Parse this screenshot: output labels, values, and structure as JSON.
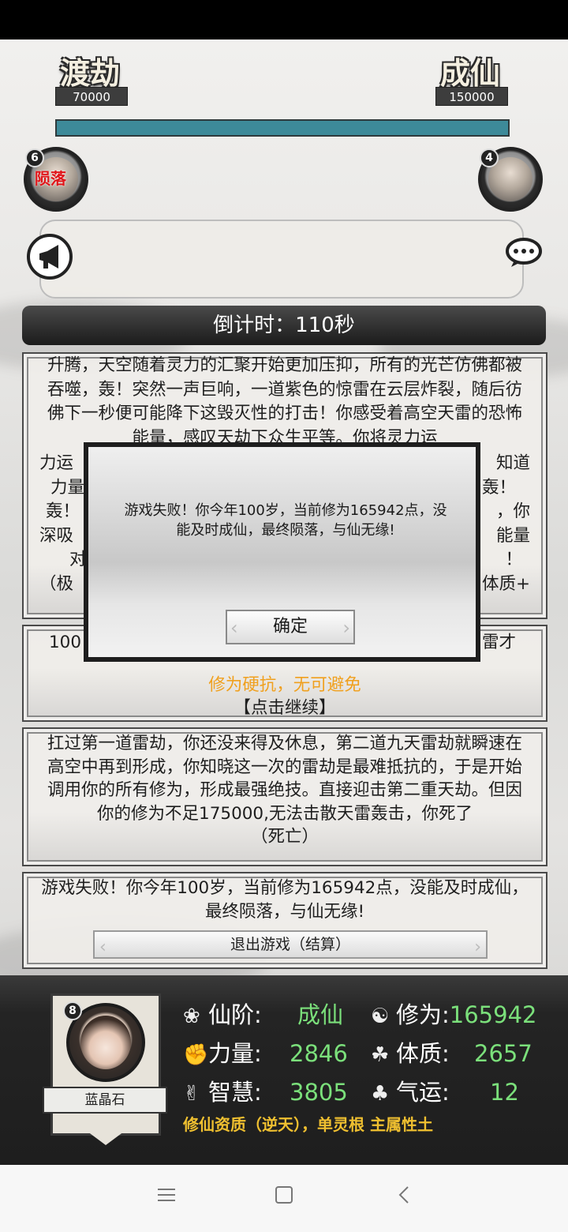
{
  "header": {
    "left_stage": "渡劫",
    "left_value": "70000",
    "right_stage": "成仙",
    "right_value": "150000",
    "progress_fraction": 1.0
  },
  "opponents": {
    "left_badge": "6",
    "left_status": "陨落",
    "right_badge": "4"
  },
  "countdown": "倒计时：110秒",
  "cards": {
    "story1": "升腾，天空随着灵力的汇聚开始更加压抑，所有的光芒仿佛都被吞噬，轰！突然一声巨响，一道紫色的惊雷在云层炸裂，随后彷佛下一秒便可能降下这毁灭性的打击！你感受着高空天雷的恐怖能量，感叹天劫下众生平等。你将灵力运",
    "story1_r1_left": "力运",
    "story1_r1_right": "知道",
    "story1_r2_left": "力量",
    "story1_r2_right": "轰！",
    "story1_r3_left": "轰！",
    "story1_r3_right": "，你",
    "story1_r4_left": "深吸",
    "story1_r4_right": "能量",
    "story1_r5_left": "对",
    "story1_r5_right": "！",
    "story1_r6_left": "（极",
    "story1_r6_right": "体质+",
    "story2_left": "100",
    "story2_right": "雷才",
    "story2_orange": "修为硬抗，无可避免",
    "story2_continue": "【点击继续】",
    "story3": "扛过第一道雷劫，你还没来得及休息，第二道九天雷劫就瞬速在高空中再到形成，你知晓这一次的雷劫是最难抵抗的，于是开始调用你的所有修为，形成最强绝技。直接迎击第二重天劫。但因你的修为不足175000,无法击散天雷轰击，你死了",
    "story3_tag": "（死亡）",
    "story4": "游戏失败！你今年100岁，当前修为165942点，没能及时成仙，最终陨落，与仙无缘!",
    "exit_label": "退出游戏（结算）"
  },
  "modal": {
    "message": "游戏失败！你今年100岁，当前修为165942点，没能及时成仙，最终陨落，与仙无缘!",
    "confirm_label": "确定"
  },
  "player": {
    "badge": "8",
    "name": "蓝晶石",
    "rank_label": "仙阶:",
    "rank_value": "成仙",
    "cultivation_label": "修为:",
    "cultivation_value": "165942",
    "strength_label": "力量:",
    "strength_value": "2846",
    "constitution_label": "体质:",
    "constitution_value": "2657",
    "wisdom_label": "智慧:",
    "wisdom_value": "3805",
    "luck_label": "气运:",
    "luck_value": "12",
    "talent": "修仙资质（逆天），单灵根 主属性土"
  },
  "colors": {
    "progress": "#3d8a99",
    "stat_value": "#7be07b",
    "talent": "#f0c030",
    "warning": "#f0a01e",
    "fallen": "#e0161a"
  }
}
